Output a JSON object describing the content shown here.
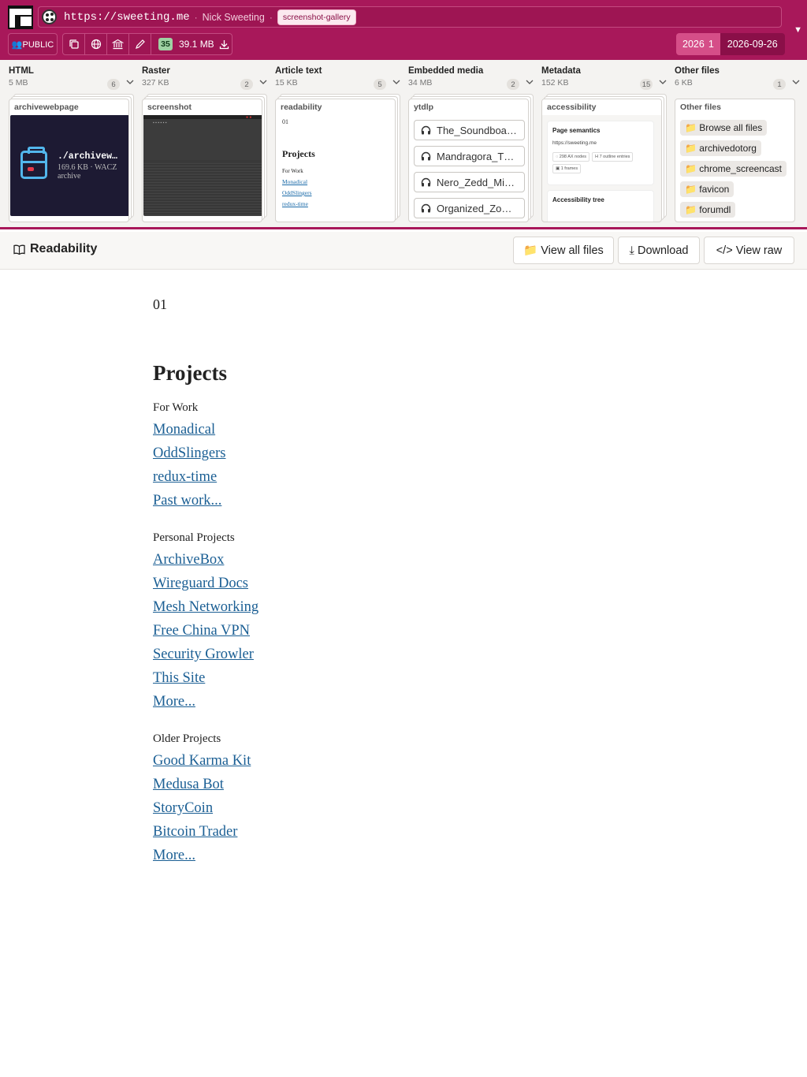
{
  "header": {
    "url": "https://sweeting.me",
    "site_title": "Nick Sweeting",
    "tag": "screenshot-gallery",
    "visibility": "👥PUBLIC",
    "file_count": "35",
    "total_size": "39.1 MB",
    "year": "2026",
    "year_count": "1",
    "date": "2026-09-26"
  },
  "columns": [
    {
      "title": "HTML",
      "size": "5 MB",
      "count": "6",
      "card_title": "archivewebpage"
    },
    {
      "title": "Raster",
      "size": "327 KB",
      "count": "2",
      "card_title": "screenshot"
    },
    {
      "title": "Article text",
      "size": "15 KB",
      "count": "5",
      "card_title": "readability"
    },
    {
      "title": "Embedded media",
      "size": "34 MB",
      "count": "2",
      "card_title": "ytdlp"
    },
    {
      "title": "Metadata",
      "size": "152 KB",
      "count": "15",
      "card_title": "accessibility"
    },
    {
      "title": "Other files",
      "size": "6 KB",
      "count": "1",
      "card_title": "Other files"
    }
  ],
  "html_preview": {
    "filename": "./archivew…",
    "size": "169.6 KB · WACZ",
    "kind": "archive"
  },
  "readability_preview": {
    "num": "01",
    "heading": "Projects",
    "section": "For Work",
    "links": [
      "Monadical",
      "OddSlingers",
      "redux-time"
    ]
  },
  "media_items": [
    "The_Soundboa…",
    "Mandragora_T…",
    "Nero_Zedd_Mi…",
    "Organized_Zo…"
  ],
  "metadata_preview": {
    "heading": "Page semantics",
    "url": "https://sweeting.me",
    "chips": [
      "◌ 298 AX nodes",
      "H 7 outline entries",
      "▣ 1 frames"
    ],
    "heading2": "Accessibility tree"
  },
  "other_files": [
    "📁 Browse all files",
    "📁 archivedotorg",
    "📁 chrome_screencast",
    "📁 favicon",
    "📁 forumdl"
  ],
  "toolbar": {
    "title": "Readability",
    "view_all": "📁 View all files",
    "download": "⤓ Download",
    "view_raw": "</> View raw"
  },
  "article": {
    "num": "01",
    "title": "Projects",
    "sections": [
      {
        "label": "For Work",
        "links": [
          "Monadical",
          "OddSlingers",
          "redux-time",
          "Past work..."
        ]
      },
      {
        "label": "Personal Projects",
        "links": [
          "ArchiveBox",
          "Wireguard Docs",
          "Mesh Networking",
          "Free China VPN",
          "Security Growler",
          "This Site",
          "More..."
        ]
      },
      {
        "label": "Older Projects",
        "links": [
          "Good Karma Kit",
          "Medusa Bot",
          "StoryCoin",
          "Bitcoin Trader",
          "More..."
        ]
      }
    ]
  },
  "colors": {
    "brand": "#a8185a",
    "link": "#1b5f94",
    "badge_green": "#9fd1a3"
  },
  "icons": {
    "book": "book-icon",
    "folder": "folder-icon",
    "headphones": "headphones-icon"
  }
}
